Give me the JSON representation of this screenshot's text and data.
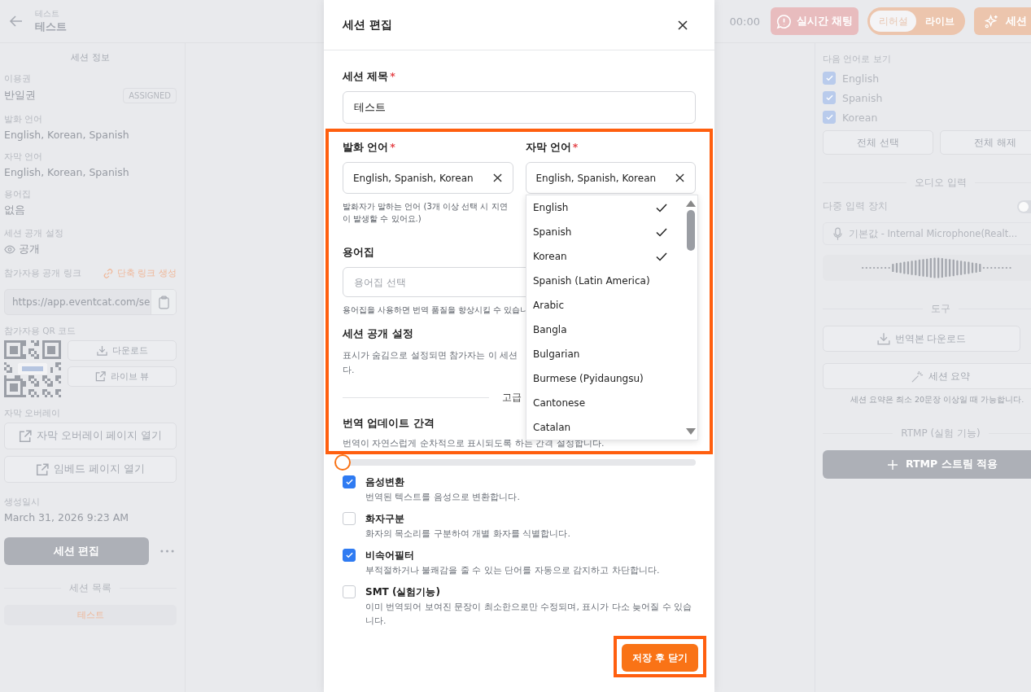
{
  "header": {
    "breadcrumb": "테스트",
    "title": "테스트"
  },
  "top_bar": {
    "timer": "00:00",
    "chat_button": "실시간 채팅",
    "mode_toggle": [
      {
        "label": "리허설",
        "selected": true
      },
      {
        "label": "라이브",
        "selected": false
      }
    ],
    "summary_button": "세션"
  },
  "sidebar": {
    "section_title": "세션 정보",
    "plan": {
      "label": "이용권",
      "value": "반일권",
      "badge": "ASSIGNED"
    },
    "fields": [
      {
        "label": "발화 언어",
        "value": "English, Korean, Spanish"
      },
      {
        "label": "자막 언어",
        "value": "English, Korean, Spanish"
      },
      {
        "label": "용어집",
        "value": "없음"
      }
    ],
    "visibility": {
      "label": "세션 공개 설정",
      "value": "공개"
    },
    "public_link": {
      "label": "참가자용 공개 링크",
      "action": "단축 링크 생성",
      "url": "https://app.eventcat.com/se"
    },
    "qr": {
      "label": "참가자용 QR 코드",
      "buttons": [
        {
          "kind": "download",
          "label": "다운로드"
        },
        {
          "kind": "external",
          "label": "라이브 뷰"
        }
      ]
    },
    "overlay": {
      "label": "자막 오버레이",
      "buttons": [
        "자막 오버레이 페이지 열기",
        "임베드 페이지 열기"
      ]
    },
    "created": {
      "label": "생성일시",
      "value": "March 31, 2026 9:23 AM"
    },
    "edit_button": "세션 편집",
    "session_list": {
      "title": "세션 목록",
      "items": [
        {
          "label": "테스트",
          "selected": true
        }
      ]
    }
  },
  "right_panel": {
    "view_languages": {
      "label": "다음 언어로 보기",
      "items": [
        {
          "label": "English",
          "checked": true
        },
        {
          "label": "Spanish",
          "checked": true
        },
        {
          "label": "Korean",
          "checked": true
        }
      ],
      "buttons": [
        "전체 선택",
        "전체 해제"
      ]
    },
    "audio": {
      "title": "오디오 입력",
      "multi_input_label": "다중 입력 장치",
      "multi_input_on": false,
      "device": "기본값 - Internal Microphone(Realt..."
    },
    "tools": {
      "title": "도구",
      "download": "번역본 다운로드",
      "summary": "세션 요약",
      "note": "세션 요약은 최소 20문장 이상일 때 가능합니다."
    },
    "rtmp": {
      "title": "RTMP (실험 기능)",
      "button": "RTMP 스트림 적용"
    }
  },
  "modal": {
    "title": "세션 편집",
    "session_title": {
      "label": "세션 제목",
      "required_mark": "*",
      "value": "테스트"
    },
    "highlighted": true,
    "speech_language": {
      "label": "발화 언어",
      "required_mark": "*",
      "value": "English, Spanish, Korean",
      "help": "발화자가 말하는 언어 (3개 이상 선택 시 지연이 발생할 수 있어요.)"
    },
    "subtitle_language": {
      "label": "자막 언어",
      "required_mark": "*",
      "value": "English, Spanish, Korean",
      "dropdown": [
        {
          "label": "English",
          "selected": true
        },
        {
          "label": "Spanish",
          "selected": true
        },
        {
          "label": "Korean",
          "selected": true
        },
        {
          "label": "Spanish (Latin America)",
          "selected": false
        },
        {
          "label": "Arabic",
          "selected": false
        },
        {
          "label": "Bangla",
          "selected": false
        },
        {
          "label": "Bulgarian",
          "selected": false
        },
        {
          "label": "Burmese (Pyidaungsu)",
          "selected": false
        },
        {
          "label": "Cantonese",
          "selected": false
        },
        {
          "label": "Catalan",
          "selected": false
        }
      ]
    },
    "glossary": {
      "label": "용어집",
      "placeholder": "용어집 선택",
      "help": "용어집을 사용하면 번역 품질을 향상시킬 수 있습니"
    },
    "visibility": {
      "label": "세션 공개 설정",
      "help_lines": [
        "표시가 숨김으로 설정되면 참가자는 이 세션",
        "다."
      ]
    },
    "advanced_divider": "고급",
    "update_interval": {
      "label": "번역 업데이트 간격",
      "help": "번역이 자연스럽게 순차적으로 표시되도록 하는 간격 설정합니다.",
      "level": 0
    },
    "options": [
      {
        "label": "음성변환",
        "description": "번역된 텍스트를 음성으로 변환합니다.",
        "checked": true
      },
      {
        "label": "화자구분",
        "description": "화자의 목소리를 구분하여 개별 화자를 식별합니다.",
        "checked": false
      },
      {
        "label": "비속어필터",
        "description": "부적절하거나 불쾌감을 줄 수 있는 단어를 자동으로 감지하고 차단합니다.",
        "checked": true
      },
      {
        "label": "SMT (실험기능)",
        "description": "이미 번역되어 보여진 문장이 최소한으로만 수정되며, 표시가 다소 늦어질 수 있습니다.",
        "checked": false
      }
    ],
    "save_button": "저장 후 닫기",
    "save_highlighted": true
  }
}
